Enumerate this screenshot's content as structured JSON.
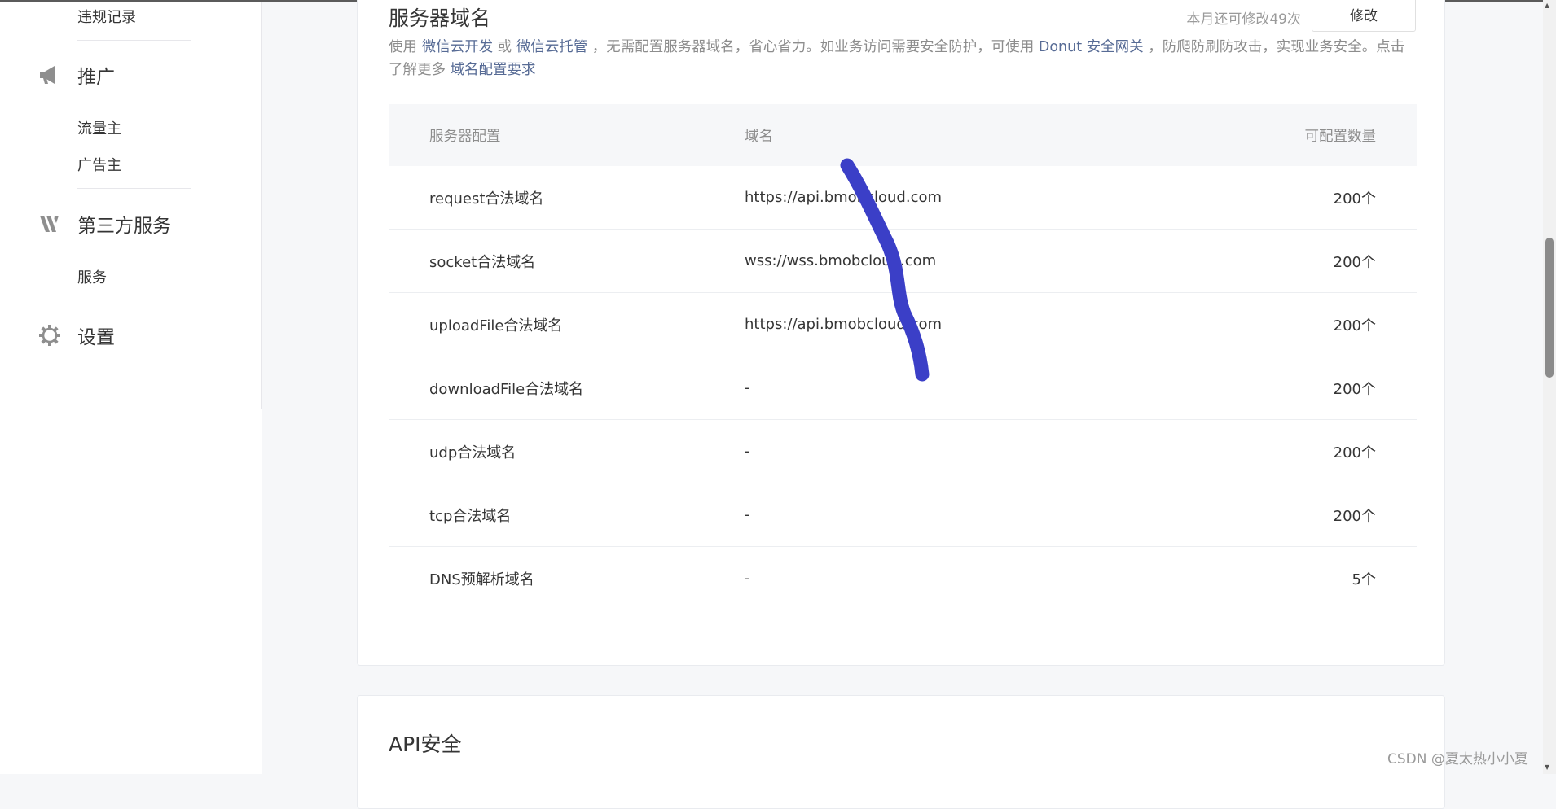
{
  "sidebar": {
    "top_item": "违规记录",
    "promo": {
      "label": "推广",
      "items": [
        "流量主",
        "广告主"
      ]
    },
    "third": {
      "label": "第三方服务",
      "items": [
        "服务"
      ]
    },
    "settings": {
      "label": "设置"
    }
  },
  "domain_section": {
    "title": "服务器域名",
    "quota_text": "本月还可修改49次",
    "edit_label": "修改",
    "desc": {
      "p1": "使用 ",
      "link1": "微信云开发",
      "p2": " 或 ",
      "link2": "微信云托管",
      "p3": " ，无需配置服务器域名，省心省力。如业务访问需要安全防护，可使用 ",
      "link3": "Donut 安全网关",
      "p4": " ，防爬防刷防攻击，实现业务安全。点击了解更多 ",
      "link4": "域名配置要求"
    },
    "table": {
      "headers": [
        "服务器配置",
        "域名",
        "可配置数量"
      ],
      "rows": [
        {
          "name": "request合法域名",
          "domain": "https://api.bmobcloud.com",
          "count": "200个"
        },
        {
          "name": "socket合法域名",
          "domain": "wss://wss.bmobcloud.com",
          "count": "200个"
        },
        {
          "name": "uploadFile合法域名",
          "domain": "https://api.bmobcloud.com",
          "count": "200个"
        },
        {
          "name": "downloadFile合法域名",
          "domain": "-",
          "count": "200个"
        },
        {
          "name": "udp合法域名",
          "domain": "-",
          "count": "200个"
        },
        {
          "name": "tcp合法域名",
          "domain": "-",
          "count": "200个"
        },
        {
          "name": "DNS预解析域名",
          "domain": "-",
          "count": "5个"
        }
      ]
    }
  },
  "api_section": {
    "title": "API安全"
  },
  "watermark": "CSDN @夏太热小小夏",
  "colors": {
    "link": "#576b95",
    "pen_stroke": "#3b3fc7"
  }
}
